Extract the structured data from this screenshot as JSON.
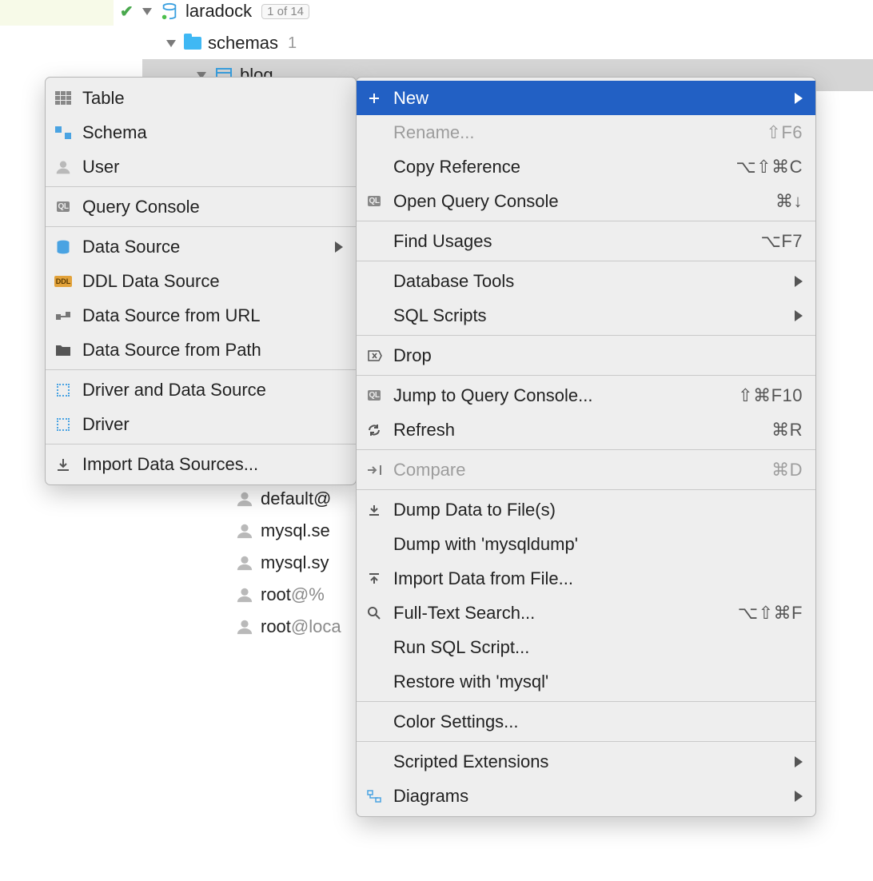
{
  "tree": {
    "root": {
      "label": "laradock",
      "badge": "1 of 14"
    },
    "schemas": {
      "label": "schemas",
      "count": "1"
    },
    "blog": {
      "label": "blog"
    },
    "users": [
      {
        "name": "default@",
        "host": ""
      },
      {
        "name": "mysql.se",
        "host": ""
      },
      {
        "name": "mysql.sy",
        "host": ""
      },
      {
        "name": "root",
        "host": "@%"
      },
      {
        "name": "root",
        "host": "@loca"
      }
    ]
  },
  "submenu": {
    "items": [
      {
        "label": "Table",
        "icon": "table-icon"
      },
      {
        "label": "Schema",
        "icon": "schema-icon"
      },
      {
        "label": "User",
        "icon": "person-icon"
      }
    ],
    "query_console": "Query Console",
    "sources": [
      {
        "label": "Data Source",
        "icon": "cyl-icon",
        "submenu": true
      },
      {
        "label": "DDL Data Source",
        "icon": "ddl-icon"
      },
      {
        "label": "Data Source from URL",
        "icon": "url-icon"
      },
      {
        "label": "Data Source from Path",
        "icon": "folder-icon"
      }
    ],
    "drivers": [
      {
        "label": "Driver and Data Source",
        "icon": "box-icon"
      },
      {
        "label": "Driver",
        "icon": "box-icon"
      }
    ],
    "import": "Import Data Sources..."
  },
  "mainmenu": {
    "g1": [
      {
        "label": "New",
        "highlight": true,
        "submenu": true,
        "icon": "plus-icon"
      },
      {
        "label": "Rename...",
        "shortcut": "⇧F6",
        "disabled": true
      },
      {
        "label": "Copy Reference",
        "shortcut": "⌥⇧⌘C"
      },
      {
        "label": "Open Query Console",
        "shortcut": "⌘↓",
        "icon": "ql-icon"
      }
    ],
    "g2": [
      {
        "label": "Find Usages",
        "shortcut": "⌥F7"
      }
    ],
    "g3": [
      {
        "label": "Database Tools",
        "submenu": true
      },
      {
        "label": "SQL Scripts",
        "submenu": true
      }
    ],
    "g4": [
      {
        "label": "Drop",
        "icon": "delete-icon"
      }
    ],
    "g5": [
      {
        "label": "Jump to Query Console...",
        "shortcut": "⇧⌘F10",
        "icon": "ql-icon"
      },
      {
        "label": "Refresh",
        "shortcut": "⌘R",
        "icon": "refresh-icon"
      }
    ],
    "g6": [
      {
        "label": "Compare",
        "shortcut": "⌘D",
        "disabled": true,
        "icon": "compare-icon"
      }
    ],
    "g7": [
      {
        "label": "Dump Data to File(s)",
        "icon": "download-icon"
      },
      {
        "label": "Dump with 'mysqldump'"
      },
      {
        "label": "Import Data from File...",
        "icon": "upload-icon"
      },
      {
        "label": "Full-Text Search...",
        "shortcut": "⌥⇧⌘F",
        "icon": "search-icon"
      },
      {
        "label": "Run SQL Script..."
      },
      {
        "label": "Restore with 'mysql'"
      }
    ],
    "g8": [
      {
        "label": "Color Settings..."
      }
    ],
    "g9": [
      {
        "label": "Scripted Extensions",
        "submenu": true
      },
      {
        "label": "Diagrams",
        "submenu": true,
        "icon": "diagram-icon"
      }
    ]
  }
}
